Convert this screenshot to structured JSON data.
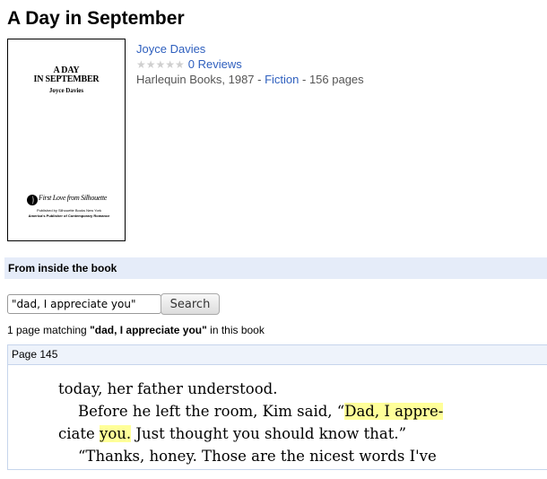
{
  "book": {
    "title": "A Day in September",
    "author": "Joyce Davies",
    "rating_stars": "★★★★★",
    "reviews_label": "0 Reviews",
    "publisher_year": "Harlequin Books, 1987 - ",
    "genre": "Fiction",
    "pages": " - 156 pages"
  },
  "cover": {
    "title_line1": "A DAY",
    "title_line2": "IN SEPTEMBER",
    "author": "Joyce Davies",
    "imprint": "First Love from Silhouette",
    "publisher_line": "Published by Silhouette Books New York",
    "tagline": "America's Publisher of Contemporary Romance"
  },
  "search_section": {
    "heading": "From inside the book",
    "query_value": "\"dad, I appreciate you\"",
    "button_label": "Search",
    "result_prefix": "1 page matching ",
    "result_query": "\"dad, I appreciate you\"",
    "result_suffix": " in this book"
  },
  "result_page": {
    "label": "Page 145",
    "line1": "today, her father understood.",
    "line2_a": "Before he left the room, Kim said, “",
    "line2_hl": "Dad, I appre-",
    "line3_a": "ciate ",
    "line3_hl": "you.",
    "line3_b": " Just thought you should know that.”",
    "line4": "“Thanks, honey. Those are the nicest words I've"
  }
}
